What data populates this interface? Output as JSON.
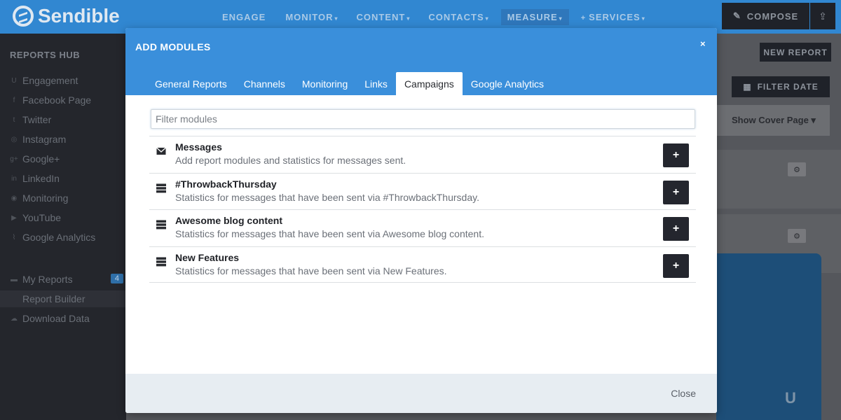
{
  "app": {
    "brand": "Sendible",
    "nav": [
      {
        "label": "ENGAGE",
        "caret": ""
      },
      {
        "label": "MONITOR",
        "caret": "▾"
      },
      {
        "label": "CONTENT",
        "caret": "▾"
      },
      {
        "label": "CONTACTS",
        "caret": "▾"
      },
      {
        "label": "MEASURE",
        "caret": "▾"
      },
      {
        "label": "SERVICES",
        "caret": "▾"
      }
    ],
    "compose_label": "COMPOSE"
  },
  "sidebar": {
    "title": "REPORTS HUB",
    "items": [
      {
        "label": "Engagement",
        "icon": "U"
      },
      {
        "label": "Facebook Page",
        "icon": "f"
      },
      {
        "label": "Twitter",
        "icon": "t"
      },
      {
        "label": "Instagram",
        "icon": "◎"
      },
      {
        "label": "Google+",
        "icon": "g+"
      },
      {
        "label": "LinkedIn",
        "icon": "in"
      },
      {
        "label": "Monitoring",
        "icon": "◉"
      },
      {
        "label": "YouTube",
        "icon": "▶"
      },
      {
        "label": "Google Analytics",
        "icon": "⌇"
      }
    ],
    "secondary": [
      {
        "label": "My Reports",
        "icon": "▬",
        "badge": "4"
      },
      {
        "label": "Report Builder",
        "icon": ""
      },
      {
        "label": "Download Data",
        "icon": "☁"
      }
    ]
  },
  "main": {
    "new_report_label": "NEW REPORT",
    "filter_date_label": "FILTER DATE",
    "cover_page_label": "Show Cover Page ▾"
  },
  "modal": {
    "title": "ADD MODULES",
    "close_symbol": "×",
    "tabs": [
      {
        "label": "General Reports"
      },
      {
        "label": "Channels"
      },
      {
        "label": "Monitoring"
      },
      {
        "label": "Links"
      },
      {
        "label": "Campaigns"
      },
      {
        "label": "Google Analytics"
      }
    ],
    "active_tab": "Campaigns",
    "filter_placeholder": "Filter modules",
    "modules": [
      {
        "name": "Messages",
        "description": "Add report modules and statistics for messages sent.",
        "icon": "envelope-icon"
      },
      {
        "name": "#ThrowbackThursday",
        "description": "Statistics for messages that have been sent via #ThrowbackThursday.",
        "icon": "stack-icon"
      },
      {
        "name": "Awesome blog content",
        "description": "Statistics for messages that have been sent via Awesome blog content.",
        "icon": "stack-icon"
      },
      {
        "name": "New Features",
        "description": "Statistics for messages that have been sent via New Features.",
        "icon": "stack-icon"
      }
    ],
    "add_symbol": "+",
    "footer_close_label": "Close"
  },
  "colors": {
    "header_blue": "#3a8fdb",
    "add_button": "#24262e",
    "footer_bg": "#e7edf2"
  }
}
